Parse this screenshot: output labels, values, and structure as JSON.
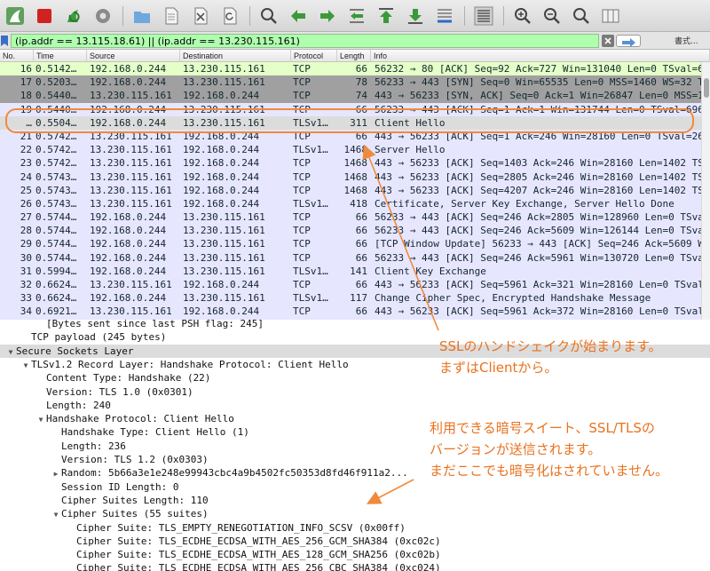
{
  "toolbar": {
    "icons": [
      "shark-fin-start-icon",
      "stop-icon",
      "restart-icon",
      "capture-options-icon",
      "open-folder-icon",
      "open-file-icon",
      "close-file-icon",
      "reload-icon",
      "find-icon",
      "go-back-icon",
      "go-forward-icon",
      "go-to-packet-icon",
      "first-packet-icon",
      "last-packet-icon",
      "autoscroll-icon",
      "colorize-icon",
      "zoom-in-icon",
      "zoom-out-icon",
      "zoom-reset-icon",
      "resize-columns-icon"
    ]
  },
  "filter": {
    "value": "(ip.addr == 13.115.18.61) || (ip.addr == 13.230.115.161)",
    "expression_label": "書式..."
  },
  "packet_list": {
    "columns": [
      "No.",
      "Time",
      "Source",
      "Destination",
      "Protocol",
      "Length",
      "Info"
    ],
    "rows": [
      {
        "no": "16",
        "time": "0.5142…",
        "src": "192.168.0.244",
        "dst": "13.230.115.161",
        "proto": "TCP",
        "len": "66",
        "info": "56232 → 80 [ACK] Seq=92 Ack=727 Win=131040 Len=0 TSval=6…",
        "bg": "#e4ffc7"
      },
      {
        "no": "17",
        "time": "0.5203…",
        "src": "192.168.0.244",
        "dst": "13.230.115.161",
        "proto": "TCP",
        "len": "78",
        "info": "56233 → 443 [SYN] Seq=0 Win=65535 Len=0 MSS=1460 WS=32 TS…",
        "bg": "#a0a0a0"
      },
      {
        "no": "18",
        "time": "0.5440…",
        "src": "13.230.115.161",
        "dst": "192.168.0.244",
        "proto": "TCP",
        "len": "74",
        "info": "443 → 56233 [SYN, ACK] Seq=0 Ack=1 Win=26847 Len=0 MSS=1…",
        "bg": "#a0a0a0"
      },
      {
        "no": "19",
        "time": "0.5440…",
        "src": "192.168.0.244",
        "dst": "13.230.115.161",
        "proto": "TCP",
        "len": "66",
        "info": "56233 → 443 [ACK] Seq=1 Ack=1 Win=131744 Len=0 TSval=696…",
        "bg": "#e7e6ff"
      },
      {
        "no": "…",
        "time": "0.5504…",
        "src": "192.168.0.244",
        "dst": "13.230.115.161",
        "proto": "TLSv1…",
        "len": "311",
        "info": "Client Hello",
        "bg": "#dcdcdc"
      },
      {
        "no": "21",
        "time": "0.5742…",
        "src": "13.230.115.161",
        "dst": "192.168.0.244",
        "proto": "TCP",
        "len": "66",
        "info": "443 → 56233 [ACK] Seq=1 Ack=246 Win=28160 Len=0 TSval=26…",
        "bg": "#e7e6ff"
      },
      {
        "no": "22",
        "time": "0.5742…",
        "src": "13.230.115.161",
        "dst": "192.168.0.244",
        "proto": "TLSv1…",
        "len": "1468",
        "info": "Server Hello",
        "bg": "#e7e6ff"
      },
      {
        "no": "23",
        "time": "0.5742…",
        "src": "13.230.115.161",
        "dst": "192.168.0.244",
        "proto": "TCP",
        "len": "1468",
        "info": "443 → 56233 [ACK] Seq=1403 Ack=246 Win=28160 Len=1402 TS…",
        "bg": "#e7e6ff"
      },
      {
        "no": "24",
        "time": "0.5743…",
        "src": "13.230.115.161",
        "dst": "192.168.0.244",
        "proto": "TCP",
        "len": "1468",
        "info": "443 → 56233 [ACK] Seq=2805 Ack=246 Win=28160 Len=1402 TS…",
        "bg": "#e7e6ff"
      },
      {
        "no": "25",
        "time": "0.5743…",
        "src": "13.230.115.161",
        "dst": "192.168.0.244",
        "proto": "TCP",
        "len": "1468",
        "info": "443 → 56233 [ACK] Seq=4207 Ack=246 Win=28160 Len=1402 TS…",
        "bg": "#e7e6ff"
      },
      {
        "no": "26",
        "time": "0.5743…",
        "src": "13.230.115.161",
        "dst": "192.168.0.244",
        "proto": "TLSv1…",
        "len": "418",
        "info": "Certificate, Server Key Exchange, Server Hello Done",
        "bg": "#e7e6ff"
      },
      {
        "no": "27",
        "time": "0.5744…",
        "src": "192.168.0.244",
        "dst": "13.230.115.161",
        "proto": "TCP",
        "len": "66",
        "info": "56233 → 443 [ACK] Seq=246 Ack=2805 Win=128960 Len=0 TSval…",
        "bg": "#e7e6ff"
      },
      {
        "no": "28",
        "time": "0.5744…",
        "src": "192.168.0.244",
        "dst": "13.230.115.161",
        "proto": "TCP",
        "len": "66",
        "info": "56233 → 443 [ACK] Seq=246 Ack=5609 Win=126144 Len=0 TSval…",
        "bg": "#e7e6ff"
      },
      {
        "no": "29",
        "time": "0.5744…",
        "src": "192.168.0.244",
        "dst": "13.230.115.161",
        "proto": "TCP",
        "len": "66",
        "info": "[TCP Window Update] 56233 → 443 [ACK] Seq=246 Ack=5609 W…",
        "bg": "#e7e6ff"
      },
      {
        "no": "30",
        "time": "0.5744…",
        "src": "192.168.0.244",
        "dst": "13.230.115.161",
        "proto": "TCP",
        "len": "66",
        "info": "56233 → 443 [ACK] Seq=246 Ack=5961 Win=130720 Len=0 TSval…",
        "bg": "#e7e6ff"
      },
      {
        "no": "31",
        "time": "0.5994…",
        "src": "192.168.0.244",
        "dst": "13.230.115.161",
        "proto": "TLSv1…",
        "len": "141",
        "info": "Client Key Exchange",
        "bg": "#e7e6ff"
      },
      {
        "no": "32",
        "time": "0.6624…",
        "src": "13.230.115.161",
        "dst": "192.168.0.244",
        "proto": "TCP",
        "len": "66",
        "info": "443 → 56233 [ACK] Seq=5961 Ack=321 Win=28160 Len=0 TSval…",
        "bg": "#e7e6ff"
      },
      {
        "no": "33",
        "time": "0.6624…",
        "src": "192.168.0.244",
        "dst": "13.230.115.161",
        "proto": "TLSv1…",
        "len": "117",
        "info": "Change Cipher Spec, Encrypted Handshake Message",
        "bg": "#e7e6ff"
      },
      {
        "no": "34",
        "time": "0.6921…",
        "src": "13.230.115.161",
        "dst": "192.168.0.244",
        "proto": "TCP",
        "len": "66",
        "info": "443 → 56233 [ACK] Seq=5961 Ack=372 Win=28160 Len=0 TSval…",
        "bg": "#e7e6ff"
      },
      {
        "no": "35",
        "time": "0.6921…",
        "src": "13.230.115.161",
        "dst": "192.168.0.244",
        "proto": "TLSv1…",
        "len": "117",
        "info": "Change Cipher Spec, Encrypted Handshake Message",
        "bg": "#e7e6ff"
      }
    ]
  },
  "details": {
    "lines": [
      {
        "text": "[Bytes sent since last PSH flag: 245]",
        "indent": 2,
        "tri": "",
        "sel": false
      },
      {
        "text": "TCP payload (245 bytes)",
        "indent": 1,
        "tri": "",
        "sel": false
      },
      {
        "text": "Secure Sockets Layer",
        "indent": 0,
        "tri": "▼",
        "sel": true
      },
      {
        "text": "TLSv1.2 Record Layer: Handshake Protocol: Client Hello",
        "indent": 1,
        "tri": "▼",
        "sel": false
      },
      {
        "text": "Content Type: Handshake (22)",
        "indent": 2,
        "tri": "",
        "sel": false
      },
      {
        "text": "Version: TLS 1.0 (0x0301)",
        "indent": 2,
        "tri": "",
        "sel": false
      },
      {
        "text": "Length: 240",
        "indent": 2,
        "tri": "",
        "sel": false
      },
      {
        "text": "Handshake Protocol: Client Hello",
        "indent": 2,
        "tri": "▼",
        "sel": false
      },
      {
        "text": "Handshake Type: Client Hello (1)",
        "indent": 3,
        "tri": "",
        "sel": false
      },
      {
        "text": "Length: 236",
        "indent": 3,
        "tri": "",
        "sel": false
      },
      {
        "text": "Version: TLS 1.2 (0x0303)",
        "indent": 3,
        "tri": "",
        "sel": false
      },
      {
        "text": "Random: 5b66a3e1e248e99943cbc4a9b4502fc50353d8fd46f911a2...",
        "indent": 3,
        "tri": "▶",
        "sel": false
      },
      {
        "text": "Session ID Length: 0",
        "indent": 3,
        "tri": "",
        "sel": false
      },
      {
        "text": "Cipher Suites Length: 110",
        "indent": 3,
        "tri": "",
        "sel": false
      },
      {
        "text": "Cipher Suites (55 suites)",
        "indent": 3,
        "tri": "▼",
        "sel": false
      },
      {
        "text": "Cipher Suite: TLS_EMPTY_RENEGOTIATION_INFO_SCSV (0x00ff)",
        "indent": 4,
        "tri": "",
        "sel": false
      },
      {
        "text": "Cipher Suite: TLS_ECDHE_ECDSA_WITH_AES_256_GCM_SHA384 (0xc02c)",
        "indent": 4,
        "tri": "",
        "sel": false
      },
      {
        "text": "Cipher Suite: TLS_ECDHE_ECDSA_WITH_AES_128_GCM_SHA256 (0xc02b)",
        "indent": 4,
        "tri": "",
        "sel": false
      },
      {
        "text": "Cipher Suite: TLS_ECDHE_ECDSA_WITH_AES_256_CBC_SHA384 (0xc024)",
        "indent": 4,
        "tri": "",
        "sel": false
      }
    ]
  },
  "annotations": {
    "note1_line1": "SSLのハンドシェイクが始まります。",
    "note1_line2": "まずはClientから。",
    "note2_line1": "利用できる暗号スイート、SSL/TLSの",
    "note2_line2": "バージョンが送信されます。",
    "note2_line3": "まだここでも暗号化はされていません。",
    "color": "#e8721e"
  }
}
